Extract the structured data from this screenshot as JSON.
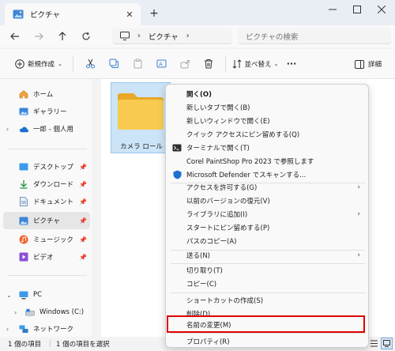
{
  "window": {
    "tab_title": "ピクチャ",
    "new_tab": "+",
    "close_tab": "✕"
  },
  "address": {
    "path": [
      "ピクチャ"
    ],
    "search_placeholder": "ピクチャの検索"
  },
  "commandbar": {
    "new_label": "新規作成",
    "sort_label": "並べ替え",
    "more_label": "···",
    "details_label": "詳細"
  },
  "nav": {
    "items": [
      {
        "label": "ホーム",
        "icon": "home-icon"
      },
      {
        "label": "ギャラリー",
        "icon": "gallery-icon"
      },
      {
        "label": "一郎 - 個人用",
        "icon": "onedrive-icon"
      },
      {
        "label": "デスクトップ",
        "icon": "desktop-icon"
      },
      {
        "label": "ダウンロード",
        "icon": "download-icon"
      },
      {
        "label": "ドキュメント",
        "icon": "document-icon"
      },
      {
        "label": "ピクチャ",
        "icon": "pictures-icon"
      },
      {
        "label": "ミュージック",
        "icon": "music-icon"
      },
      {
        "label": "ビデオ",
        "icon": "video-icon"
      },
      {
        "label": "PC",
        "icon": "pc-icon"
      },
      {
        "label": "Windows (C:)",
        "icon": "drive-icon"
      },
      {
        "label": "ネットワーク",
        "icon": "network-icon"
      }
    ]
  },
  "content": {
    "folder_name": "カメラ ロール"
  },
  "status": {
    "count": "1 個の項目",
    "selected": "1 個の項目を選択"
  },
  "context_menu": {
    "items": [
      {
        "label": "開く(O)"
      },
      {
        "label": "新しいタブで開く(B)"
      },
      {
        "label": "新しいウィンドウで開く(E)"
      },
      {
        "label": "クイック アクセスにピン留めする(Q)"
      },
      {
        "label": "ターミナルで開く(T)"
      },
      {
        "label": "Corel PaintShop Pro 2023 で参照します"
      },
      {
        "label": "Microsoft Defender でスキャンする..."
      },
      {
        "label": "アクセスを許可する(G)"
      },
      {
        "label": "以前のバージョンの復元(V)"
      },
      {
        "label": "ライブラリに追加(I)"
      },
      {
        "label": "スタートにピン留めする(P)"
      },
      {
        "label": "パスのコピー(A)"
      },
      {
        "label": "送る(N)"
      },
      {
        "label": "切り取り(T)"
      },
      {
        "label": "コピー(C)"
      },
      {
        "label": "ショートカットの作成(S)"
      },
      {
        "label": "削除(D)"
      },
      {
        "label": "名前の変更(M)"
      },
      {
        "label": "プロパティ(R)"
      }
    ]
  },
  "colors": {
    "accent": "#0067c0",
    "folder": "#f8cb50",
    "highlight": "#e00000"
  }
}
